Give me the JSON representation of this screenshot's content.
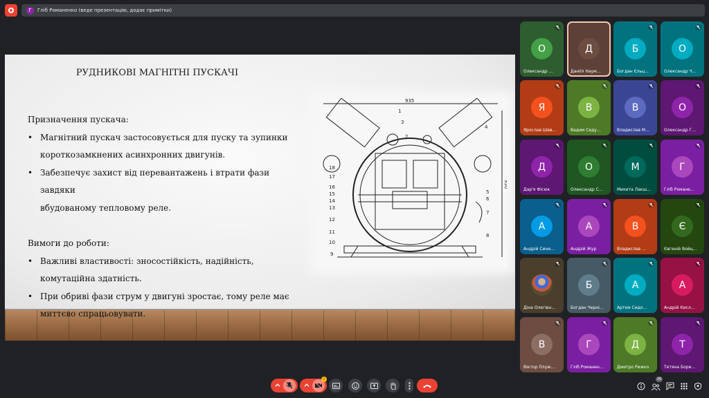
{
  "presenter": {
    "avatar_letter": "Г",
    "text": "Гліб Романенко (веде презентацію, додає примітки)"
  },
  "slide": {
    "title": "РУДНИКОВІ МАГНІТНІ ПУСКАЧІ",
    "section1": "Призначення пускача:",
    "bullets1": [
      "Магнітний пускач застосовується для пуску та зупинки",
      "короткозамкнених асинхронних двигунів.",
      "Забезпечує захист від перевантажень і втрати фази завдяки",
      "вбудованому тепловому реле."
    ],
    "section2": "Вимоги до роботи:",
    "bullets2": [
      "Важливі властивості: зносостійкість, надійність,",
      "комутаційна здатність.",
      "При обриві фази струм у двигуні зростає, тому реле має",
      "миттєво спрацьовувати."
    ],
    "diagram_labels": [
      "1",
      "2",
      "3",
      "4",
      "5",
      "6",
      "7",
      "8",
      "9",
      "10",
      "11",
      "12",
      "13",
      "14",
      "15",
      "16",
      "17",
      "18",
      "935",
      "950"
    ]
  },
  "participants": [
    {
      "letter": "О",
      "name": "Олександр ...",
      "bg": "#43a047",
      "tile": "#2e5d2f",
      "muted": true
    },
    {
      "letter": "Д",
      "name": "Даніїл Наум...",
      "bg": "#6d4c41",
      "tile": "#5d4037",
      "muted": false,
      "active": true
    },
    {
      "letter": "Б",
      "name": "Богдан Єльц...",
      "bg": "#00acc1",
      "tile": "#00737f",
      "muted": true
    },
    {
      "letter": "О",
      "name": "Олександр Ч...",
      "bg": "#00acc1",
      "tile": "#00737f",
      "muted": true
    },
    {
      "letter": "Я",
      "name": "Ярослав Шев...",
      "bg": "#f4511e",
      "tile": "#b23c16",
      "muted": true
    },
    {
      "letter": "В",
      "name": "Вадим Седу...",
      "bg": "#7cb342",
      "tile": "#4e7a27",
      "muted": true
    },
    {
      "letter": "В",
      "name": "Владислав М...",
      "bg": "#5c6bc0",
      "tile": "#3a4694",
      "muted": true
    },
    {
      "letter": "О",
      "name": "Олександр Г...",
      "bg": "#8e24aa",
      "tile": "#5e1773",
      "muted": true
    },
    {
      "letter": "Д",
      "name": "Дар'я Фісюк",
      "bg": "#8e24aa",
      "tile": "#5e1773",
      "muted": true
    },
    {
      "letter": "О",
      "name": "Олександр С...",
      "bg": "#2e7d32",
      "tile": "#1f5622",
      "muted": true
    },
    {
      "letter": "М",
      "name": "Микита Лакш...",
      "bg": "#00695c",
      "tile": "#004d40",
      "muted": true
    },
    {
      "letter": "Г",
      "name": "Гліб Романе...",
      "bg": "#ab47bc",
      "tile": "#7b1fa2",
      "muted": true
    },
    {
      "letter": "А",
      "name": "Андрій Сине...",
      "bg": "#039be5",
      "tile": "#0a5f8c",
      "muted": true
    },
    {
      "letter": "А",
      "name": "Андрій Жур",
      "bg": "#ab47bc",
      "tile": "#7b1fa2",
      "muted": true
    },
    {
      "letter": "В",
      "name": "Владислав ...",
      "bg": "#f4511e",
      "tile": "#b23c16",
      "muted": true
    },
    {
      "letter": "Є",
      "name": "Євгеній Войц...",
      "bg": "#33691e",
      "tile": "#23470f",
      "muted": true
    },
    {
      "letter": "",
      "name": "Діна Олегівн...",
      "bg": "#6d5a3a",
      "tile": "#4a3f2c",
      "muted": true,
      "photo": true
    },
    {
      "letter": "Б",
      "name": "Богдан Черні...",
      "bg": "#607d8b",
      "tile": "#455a64",
      "muted": true
    },
    {
      "letter": "А",
      "name": "Артем Сидо...",
      "bg": "#00acc1",
      "tile": "#00737f",
      "muted": true
    },
    {
      "letter": "А",
      "name": "Андрій Кисл...",
      "bg": "#d81b60",
      "tile": "#961244",
      "muted": true
    },
    {
      "letter": "В",
      "name": "Віктор Плуж...",
      "bg": "#8d6e63",
      "tile": "#6d4c41",
      "muted": true
    },
    {
      "letter": "Г",
      "name": "Гліб Романен...",
      "bg": "#ab47bc",
      "tile": "#7b1fa2",
      "muted": true
    },
    {
      "letter": "Д",
      "name": "Дмитро Рижко",
      "bg": "#7cb342",
      "tile": "#4e7a27",
      "muted": true
    },
    {
      "letter": "Т",
      "name": "Тетяна Бори...",
      "bg": "#8e24aa",
      "tile": "#5e1773",
      "muted": true
    }
  ],
  "toolbar": {
    "camera_badge": "!",
    "people_count": "26",
    "icons": [
      "chevron-up-icon",
      "mic-off-icon",
      "chevron-up-icon",
      "camera-off-icon",
      "captions-icon",
      "emoji-icon",
      "present-icon",
      "raise-hand-icon",
      "more-icon",
      "end-call-icon",
      "info-icon",
      "people-icon",
      "chat-icon",
      "activities-icon",
      "host-controls-icon"
    ]
  }
}
